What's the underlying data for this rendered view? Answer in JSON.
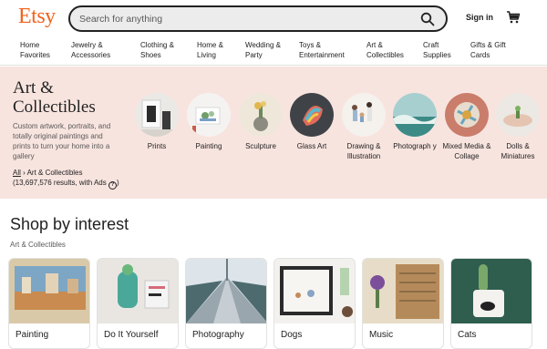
{
  "header": {
    "logo": "Etsy",
    "search_placeholder": "Search for anything",
    "search_icon": "search-icon",
    "signin_label": "Sign in",
    "cart_icon": "shopping-cart-icon"
  },
  "nav": {
    "items": [
      {
        "label": "Home\nFavorites"
      },
      {
        "label": "Jewelry &\nAccessories"
      },
      {
        "label": "Clothing &\nShoes"
      },
      {
        "label": "Home &\nLiving"
      },
      {
        "label": "Wedding &\nParty"
      },
      {
        "label": "Toys &\nEntertainment"
      },
      {
        "label": "Art &\nCollectibles"
      },
      {
        "label": "Craft\nSupplies"
      },
      {
        "label": "Gifts & Gift\nCards"
      }
    ]
  },
  "hero": {
    "title": "Art & Collectibles",
    "description": "Custom artwork, portraits, and totally original paintings and prints to turn your home into a gallery",
    "breadcrumb": {
      "all": "All",
      "separator": "›",
      "current": "Art & Collectibles"
    },
    "results": "(13,697,576 results, with Ads",
    "results_close": ")",
    "help_icon": "question-circle-icon",
    "categories": [
      {
        "label": "Prints"
      },
      {
        "label": "Painting"
      },
      {
        "label": "Sculpture"
      },
      {
        "label": "Glass Art"
      },
      {
        "label": "Drawing & Illustration"
      },
      {
        "label": "Photograph y"
      },
      {
        "label": "Mixed Media & Collage"
      },
      {
        "label": "Dolls & Miniatures"
      }
    ]
  },
  "interest": {
    "title": "Shop by interest",
    "subtitle": "Art & Collectibles",
    "cards": [
      {
        "label": "Painting"
      },
      {
        "label": "Do It Yourself"
      },
      {
        "label": "Photography"
      },
      {
        "label": "Dogs"
      },
      {
        "label": "Music"
      },
      {
        "label": "Cats"
      }
    ]
  },
  "colors": {
    "brand": "#f1641e",
    "hero_background": "#f8e4df",
    "text": "#222222",
    "muted_text": "#595959"
  }
}
